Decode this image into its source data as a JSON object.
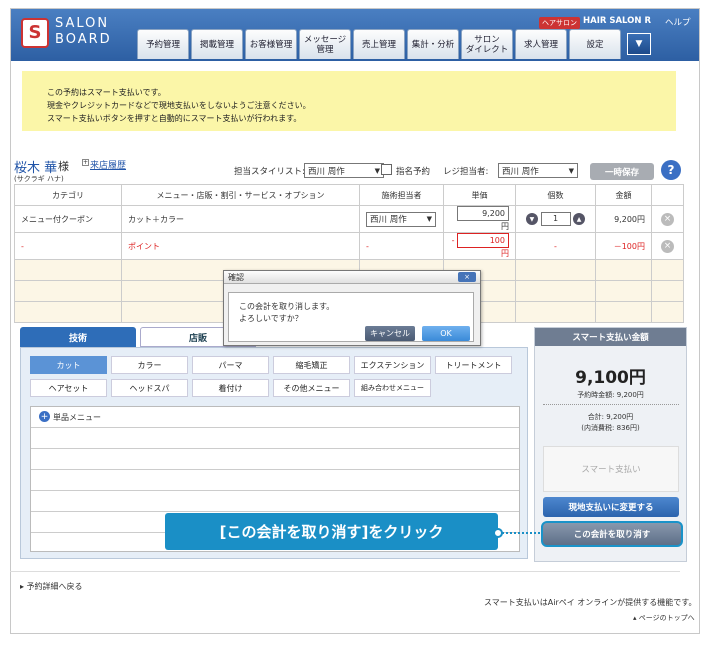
{
  "header": {
    "logo_mark": "S",
    "logo_line1": "SALON",
    "logo_line2": "BOARD",
    "shop_badge": "ヘアサロン",
    "shop_name": "HAIR SALON R",
    "help": "ヘルプ",
    "nav": [
      "予約管理",
      "掲載管理",
      "お客様管理",
      "メッセージ\n管理",
      "売上管理",
      "集計・分析",
      "サロン\nダイレクト",
      "求人管理",
      "設定"
    ],
    "nav_menu_icon": "▼"
  },
  "notice": {
    "lines": [
      "この予約はスマート支払いです。",
      "現金やクレジットカードなどで現地支払いをしないようご注意ください。",
      "スマート支払いボタンを押すと自動的にスマート支払いが行われます。"
    ]
  },
  "customer": {
    "name": "桜木 華",
    "honorific": "様",
    "kana": "(サクラギ ハナ)",
    "history_link": "来店履歴"
  },
  "toolbar": {
    "stylist_label": "担当スタイリスト:",
    "stylist_value": "西川 周作",
    "designate_label": "指名予約",
    "register_label": "レジ担当者:",
    "register_value": "西川 周作",
    "hold_button": "一時保存",
    "help_button": "?"
  },
  "table": {
    "headers": [
      "カテゴリ",
      "メニュー・店販・割引・サービス・オプション",
      "施術担当者",
      "単価",
      "個数",
      "金額"
    ],
    "row1": {
      "category": "メニュー付クーポン",
      "menu": "カット＋カラー",
      "staff": "西川 周作",
      "price": "9,200",
      "yen": "円",
      "qty": "1",
      "amount": "9,200円"
    },
    "row2": {
      "category": "-",
      "menu": "ポイント",
      "staff": "-",
      "price_prefix": "-",
      "price": "100",
      "yen": "円",
      "qty": "-",
      "amount": "－100円"
    }
  },
  "tabs": {
    "tech": "技術",
    "retail": "店販"
  },
  "categories": [
    "カット",
    "カラー",
    "パーマ",
    "縮毛矯正",
    "エクステンション",
    "トリートメント",
    "ヘアセット",
    "ヘッドスパ",
    "着付け",
    "その他メニュー",
    "組み合わせメニュー"
  ],
  "menu_list": {
    "single_menu": "単品メニュー"
  },
  "smart_pay": {
    "title": "スマート支払い金額",
    "amount": "9,100円",
    "scheduled": "予約時金額: 9,200円",
    "total": "合計: 9,200円",
    "tax": "(内消費税: 836円)",
    "pay_button": "スマート支払い",
    "change_button": "現地支払いに変更する",
    "cancel_button": "この会計を取り消す"
  },
  "callout": "[この会計を取り消す]をクリック",
  "dialog": {
    "title": "確認",
    "close_icon": "×",
    "message_line1": "この会計を取り消します。",
    "message_line2": "よろしいですか？",
    "cancel": "キャンセル",
    "ok": "OK"
  },
  "footer": {
    "back_link": "予約詳細へ戻る",
    "note": "スマート支払いはAirペイ オンラインが提供する機能です。",
    "page_top": "ページのトップへ"
  }
}
